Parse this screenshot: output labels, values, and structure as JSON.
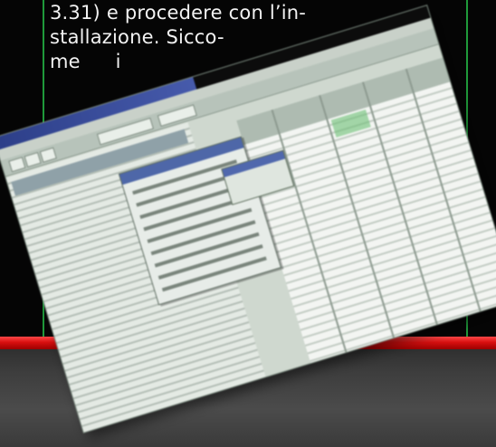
{
  "article": {
    "line1": "3.31) e procedere con l’in-",
    "line2": "stallazione. Sicco-",
    "line3": "me i"
  },
  "colors": {
    "background": "#050505",
    "frame_green": "#1f9a3a",
    "accent_red": "#d80f0f",
    "text": "#f2f2f2"
  }
}
